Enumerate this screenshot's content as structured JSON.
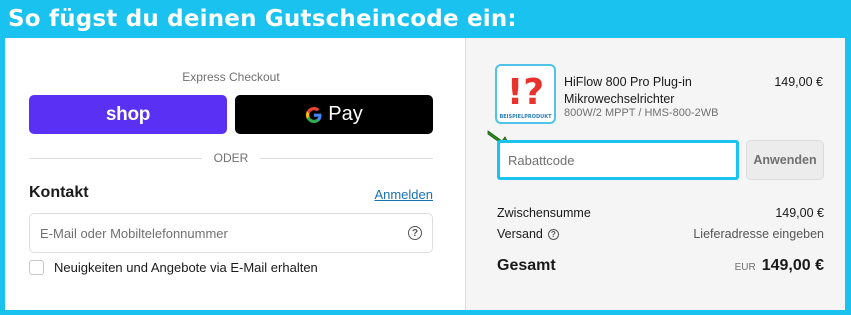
{
  "banner": {
    "title": "So fügst du deinen Gutscheincode ein:"
  },
  "express_checkout": {
    "title": "Express Checkout",
    "shop_label": "shop",
    "gpay_label": "Pay",
    "divider_label": "ODER"
  },
  "contact": {
    "heading": "Kontakt",
    "login_link": "Anmelden",
    "email_placeholder": "E-Mail oder Mobiltelefonnummer",
    "newsletter_label": "Neuigkeiten und Angebote via E-Mail erhalten"
  },
  "product": {
    "name": "HiFlow 800 Pro Plug-in Mikrowechselrichter",
    "variant": "800W/2 MPPT / HMS-800-2WB",
    "price": "149,00 €",
    "thumbnail_mark": "!?",
    "thumbnail_caption": "BEISPIELPRODUKT"
  },
  "discount": {
    "placeholder": "Rabattcode",
    "apply_label": "Anwenden"
  },
  "summary": {
    "subtotal_label": "Zwischensumme",
    "subtotal_value": "149,00 €",
    "shipping_label": "Versand",
    "shipping_value": "Lieferadresse eingeben",
    "total_label": "Gesamt",
    "currency": "EUR",
    "total_value": "149,00 €"
  },
  "colors": {
    "frame": "#19c2ef",
    "shop_pay": "#5a31f4",
    "link": "#1773b0",
    "highlight_arrow": "#2e8b1e",
    "thumbnail_mark": "#e8322b"
  },
  "icons": {
    "help": "question-circle-icon",
    "arrow": "green-arrow-icon",
    "google": "google-g-icon"
  }
}
